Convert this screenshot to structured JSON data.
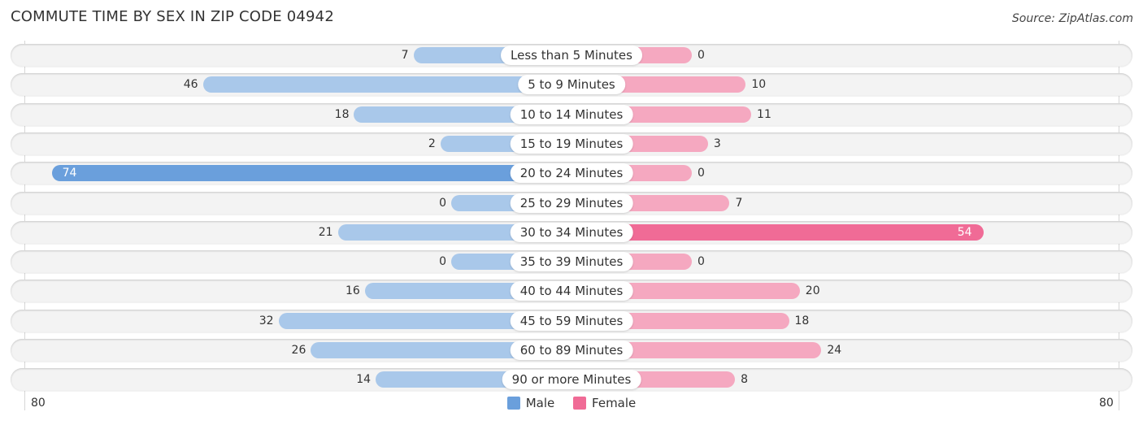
{
  "header": {
    "title": "COMMUTE TIME BY SEX IN ZIP CODE 04942",
    "source": "Source: ZipAtlas.com"
  },
  "colors": {
    "male_strong": "#6a9fdc",
    "male_light": "#a9c8ea",
    "female_strong": "#f06b96",
    "female_light": "#f5a8c0"
  },
  "chart_data": {
    "type": "bar",
    "orientation": "horizontal-diverging",
    "title": "COMMUTE TIME BY SEX IN ZIP CODE 04942",
    "categories": [
      "Less than 5 Minutes",
      "5 to 9 Minutes",
      "10 to 14 Minutes",
      "15 to 19 Minutes",
      "20 to 24 Minutes",
      "25 to 29 Minutes",
      "30 to 34 Minutes",
      "35 to 39 Minutes",
      "40 to 44 Minutes",
      "45 to 59 Minutes",
      "60 to 89 Minutes",
      "90 or more Minutes"
    ],
    "series": [
      {
        "name": "Male",
        "values": [
          7,
          46,
          18,
          2,
          74,
          0,
          21,
          0,
          16,
          32,
          26,
          14
        ]
      },
      {
        "name": "Female",
        "values": [
          0,
          10,
          11,
          3,
          0,
          7,
          54,
          0,
          20,
          18,
          24,
          8
        ]
      }
    ],
    "axis": {
      "left_label": "80",
      "right_label": "80",
      "range": [
        -80,
        80
      ]
    },
    "legend": {
      "position": "bottom-center",
      "entries": [
        "Male",
        "Female"
      ]
    },
    "xlabel": "",
    "ylabel": ""
  }
}
